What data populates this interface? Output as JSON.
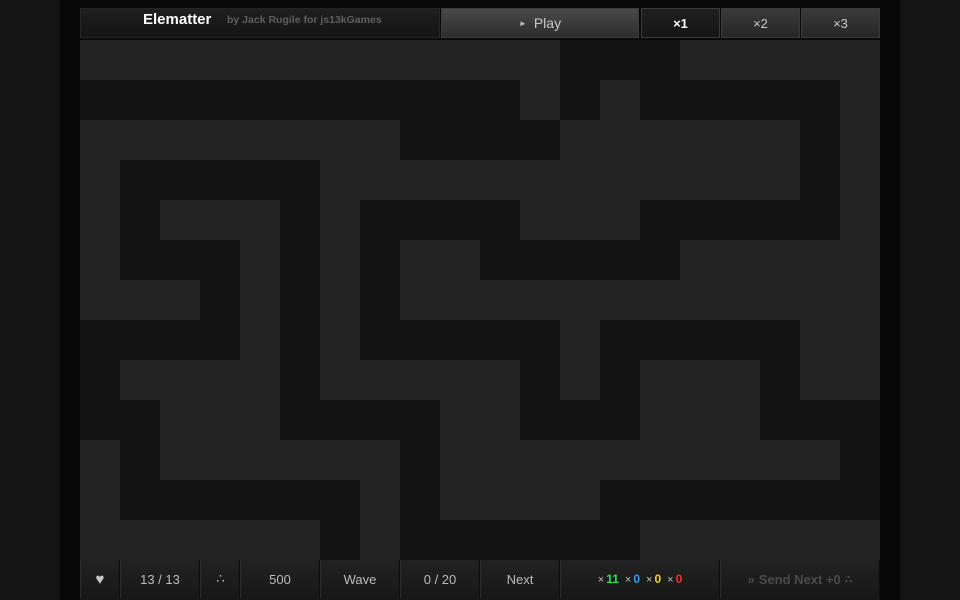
{
  "header": {
    "title": "Elematter",
    "credit": "by Jack Rugile for js13kGames",
    "play_label": "Play",
    "play_icon": "play-triangle-icon",
    "speeds": [
      "×1",
      "×2",
      "×3"
    ],
    "active_speed": "×1"
  },
  "maze": {
    "grid_cols": 20,
    "grid_rows": 13,
    "path_color": "#131313",
    "wall_color": "#232323",
    "path_cells": [
      [
        0,
        12
      ],
      [
        0,
        13
      ],
      [
        0,
        14
      ],
      [
        1,
        0
      ],
      [
        1,
        1
      ],
      [
        1,
        2
      ],
      [
        1,
        3
      ],
      [
        1,
        4
      ],
      [
        1,
        5
      ],
      [
        1,
        6
      ],
      [
        1,
        7
      ],
      [
        1,
        8
      ],
      [
        1,
        9
      ],
      [
        1,
        10
      ],
      [
        1,
        12
      ],
      [
        1,
        14
      ],
      [
        1,
        15
      ],
      [
        1,
        16
      ],
      [
        1,
        17
      ],
      [
        1,
        18
      ],
      [
        2,
        8
      ],
      [
        2,
        9
      ],
      [
        2,
        10
      ],
      [
        2,
        11
      ],
      [
        2,
        18
      ],
      [
        3,
        1
      ],
      [
        3,
        2
      ],
      [
        3,
        3
      ],
      [
        3,
        4
      ],
      [
        3,
        5
      ],
      [
        3,
        18
      ],
      [
        4,
        1
      ],
      [
        4,
        5
      ],
      [
        4,
        7
      ],
      [
        4,
        8
      ],
      [
        4,
        9
      ],
      [
        4,
        10
      ],
      [
        4,
        14
      ],
      [
        4,
        15
      ],
      [
        4,
        16
      ],
      [
        4,
        17
      ],
      [
        4,
        18
      ],
      [
        5,
        1
      ],
      [
        5,
        2
      ],
      [
        5,
        3
      ],
      [
        5,
        5
      ],
      [
        5,
        7
      ],
      [
        5,
        10
      ],
      [
        5,
        11
      ],
      [
        5,
        12
      ],
      [
        5,
        13
      ],
      [
        5,
        14
      ],
      [
        6,
        3
      ],
      [
        6,
        5
      ],
      [
        6,
        7
      ],
      [
        7,
        0
      ],
      [
        7,
        1
      ],
      [
        7,
        2
      ],
      [
        7,
        3
      ],
      [
        7,
        5
      ],
      [
        7,
        7
      ],
      [
        7,
        8
      ],
      [
        7,
        9
      ],
      [
        7,
        10
      ],
      [
        7,
        11
      ],
      [
        7,
        13
      ],
      [
        7,
        14
      ],
      [
        7,
        15
      ],
      [
        7,
        16
      ],
      [
        7,
        17
      ],
      [
        8,
        0
      ],
      [
        8,
        5
      ],
      [
        8,
        11
      ],
      [
        8,
        13
      ],
      [
        8,
        17
      ],
      [
        9,
        0
      ],
      [
        9,
        1
      ],
      [
        9,
        5
      ],
      [
        9,
        6
      ],
      [
        9,
        7
      ],
      [
        9,
        8
      ],
      [
        9,
        11
      ],
      [
        9,
        12
      ],
      [
        9,
        13
      ],
      [
        9,
        17
      ],
      [
        9,
        18
      ],
      [
        9,
        19
      ],
      [
        10,
        1
      ],
      [
        10,
        8
      ],
      [
        10,
        19
      ],
      [
        11,
        1
      ],
      [
        11,
        2
      ],
      [
        11,
        3
      ],
      [
        11,
        4
      ],
      [
        11,
        5
      ],
      [
        11,
        6
      ],
      [
        11,
        8
      ],
      [
        11,
        13
      ],
      [
        11,
        14
      ],
      [
        11,
        15
      ],
      [
        11,
        16
      ],
      [
        11,
        17
      ],
      [
        11,
        18
      ],
      [
        11,
        19
      ],
      [
        12,
        6
      ],
      [
        12,
        8
      ],
      [
        12,
        9
      ],
      [
        12,
        10
      ],
      [
        12,
        11
      ],
      [
        12,
        12
      ],
      [
        12,
        13
      ]
    ]
  },
  "footer": {
    "lives_icon": "heart-icon",
    "lives": "13 / 13",
    "resource_icon": "dots-icon",
    "resource": "500",
    "wave_label": "Wave",
    "wave_progress": "0 / 20",
    "next_label": "Next",
    "counters": [
      {
        "mult": "×",
        "value": "11",
        "color": "#2fe04a"
      },
      {
        "mult": "×",
        "value": "0",
        "color": "#2ea3f2"
      },
      {
        "mult": "×",
        "value": "0",
        "color": "#f2d32a"
      },
      {
        "mult": "×",
        "value": "0",
        "color": "#f0322e"
      }
    ],
    "send_prefix": "»",
    "send_label": "Send Next +0",
    "send_suffix": "∴"
  }
}
